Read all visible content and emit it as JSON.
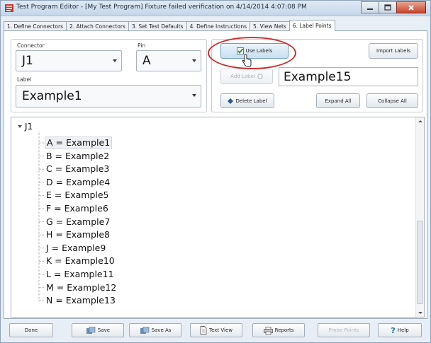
{
  "window": {
    "title": "Test Program Editor - [My Test Program]   Fixture failed verification on 4/14/2014 4:07:08 PM"
  },
  "tabs": [
    {
      "label": "1. Define Connectors"
    },
    {
      "label": "2. Attach Connectors"
    },
    {
      "label": "3. Set Test Defaults"
    },
    {
      "label": "4. Define Instructions"
    },
    {
      "label": "5. View Nets"
    },
    {
      "label": "6. Label Points"
    }
  ],
  "form": {
    "connector_label": "Connector",
    "connector_value": "J1",
    "pin_label": "Pin",
    "pin_value": "A",
    "label_label": "Label",
    "label_value": "Example1",
    "use_labels": "Use Labels",
    "use_labels_checked": true,
    "import_labels": "Import Labels",
    "add_label": "Add Label",
    "new_label_value": "Example15",
    "delete_label": "Delete Label",
    "expand_all": "Expand All",
    "collapse_all": "Collapse All"
  },
  "tree": {
    "root": "J1",
    "items": [
      "A = Example1",
      "B = Example2",
      "C = Example3",
      "D = Example4",
      "E = Example5",
      "F = Example6",
      "G = Example7",
      "H = Example8",
      "J = Example9",
      "K = Example10",
      "L = Example11",
      "M = Example12",
      "N = Example13"
    ],
    "selected_index": 0
  },
  "bottom": {
    "done": "Done",
    "save": "Save",
    "save_as": "Save As",
    "text_view": "Text View",
    "reports": "Reports",
    "probe_points": "Probe Points",
    "help": "Help"
  },
  "colors": {
    "highlight": "#cf2f2f",
    "accent": "#2f7fbf"
  }
}
